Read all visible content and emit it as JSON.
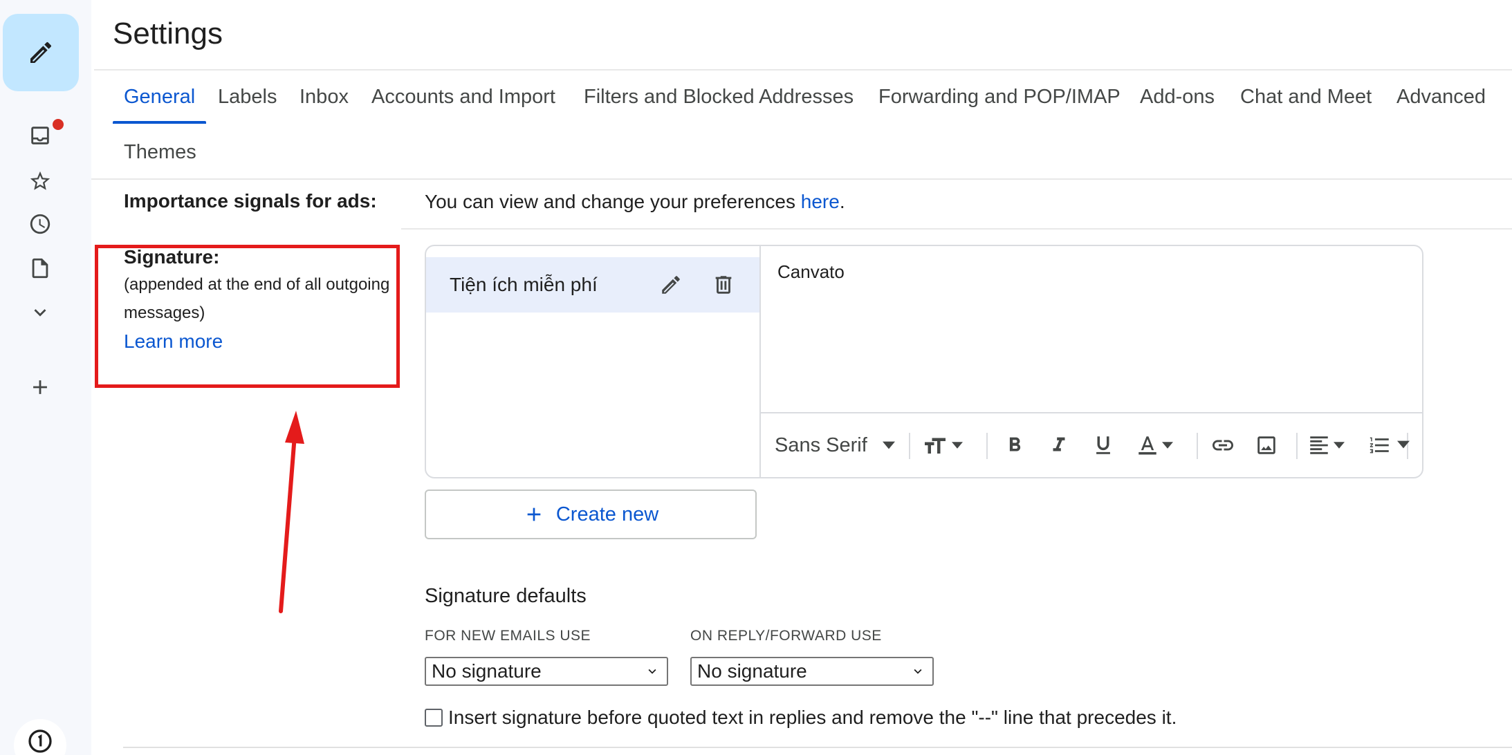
{
  "page": {
    "title": "Settings"
  },
  "tabs": [
    {
      "label": "General",
      "active": true
    },
    {
      "label": "Labels"
    },
    {
      "label": "Inbox"
    },
    {
      "label": "Accounts and Import"
    },
    {
      "label": "Filters and Blocked Addresses"
    },
    {
      "label": "Forwarding and POP/IMAP"
    },
    {
      "label": "Add-ons"
    },
    {
      "label": "Chat and Meet"
    },
    {
      "label": "Advanced"
    },
    {
      "label": "Themes"
    }
  ],
  "importance": {
    "label": "Importance signals for ads:",
    "text_before": "You can view and change your preferences ",
    "link": "here",
    "text_after": "."
  },
  "signature": {
    "label": "Signature:",
    "desc_line1": "(appended at the end of all outgoing",
    "desc_line2": "messages)",
    "learn_more": "Learn more",
    "items": [
      {
        "name": "Tiện ích miễn phí"
      }
    ],
    "content": "Canvato",
    "toolbar": {
      "font": "Sans Serif"
    },
    "create_new": "Create new"
  },
  "defaults": {
    "title": "Signature defaults",
    "new_label": "FOR NEW EMAILS USE",
    "new_value": "No signature",
    "reply_label": "ON REPLY/FORWARD USE",
    "reply_value": "No signature",
    "insert_before_label": "Insert signature before quoted text in replies and remove the \"--\" line that precedes it.",
    "insert_before_checked": false
  },
  "colors": {
    "accent": "#0b57d0",
    "compose_bg": "#c2e7ff",
    "annotation": "#e41b1b",
    "selected_row": "#e8eefb"
  }
}
